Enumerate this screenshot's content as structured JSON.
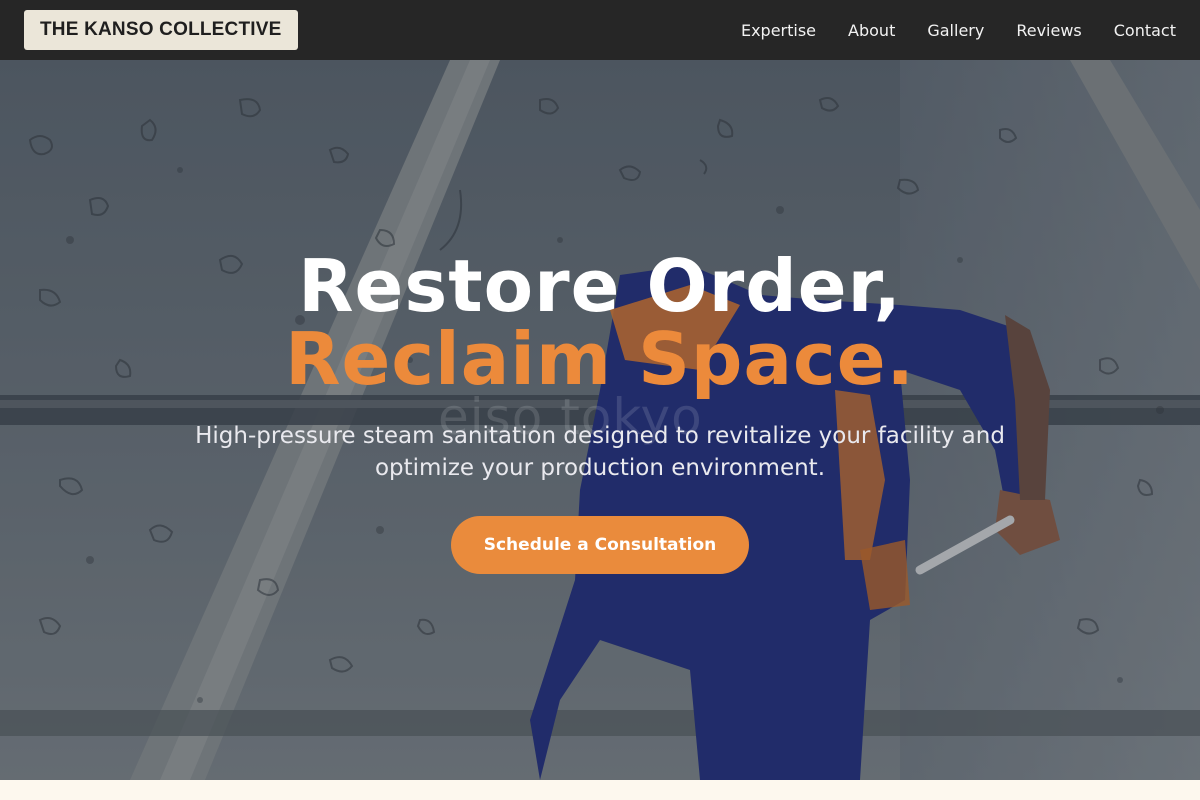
{
  "brand": {
    "name": "THE KANSO COLLECTIVE"
  },
  "nav": {
    "items": [
      {
        "label": "Expertise"
      },
      {
        "label": "About"
      },
      {
        "label": "Gallery"
      },
      {
        "label": "Reviews"
      },
      {
        "label": "Contact"
      }
    ]
  },
  "hero": {
    "headline_line1": "Restore Order,",
    "headline_line2": "Reclaim Space.",
    "subtitle": "High-pressure steam sanitation designed to revitalize your facility and optimize your production environment.",
    "cta_label": "Schedule a Consultation",
    "watermark": "eiso tokyo",
    "image": "worker-cleaning-glass-roof"
  },
  "colors": {
    "nav_bg": "#262626",
    "accent": "#ec8a3b",
    "brand_bg": "#ebe6d9",
    "page_bg": "#fdf8ee"
  }
}
